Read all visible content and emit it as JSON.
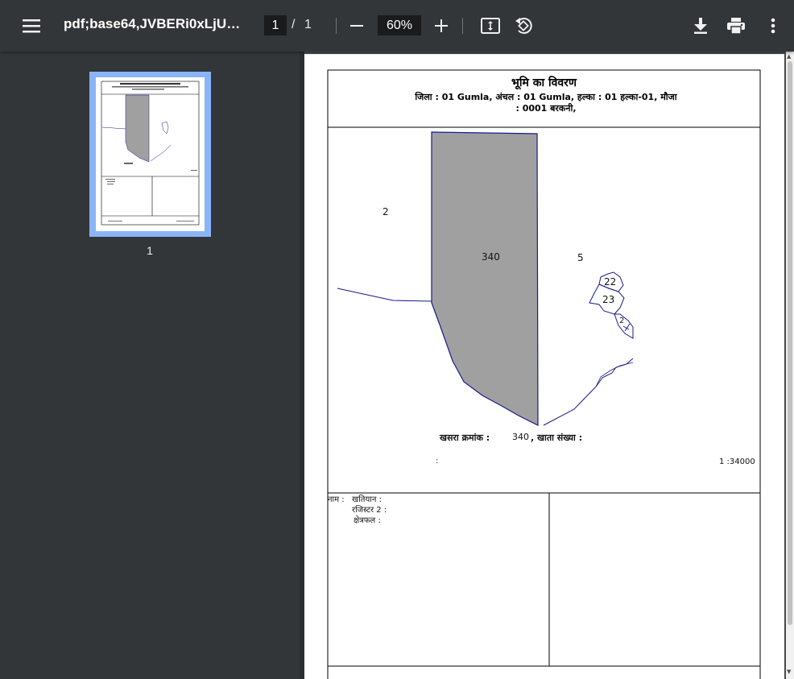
{
  "toolbar": {
    "title": "pdf;base64,JVBERi0xLjUKJ...",
    "current_page": "1",
    "page_separator": "/",
    "total_pages": "1",
    "zoom": "60%"
  },
  "sidebar": {
    "thumbnails": [
      {
        "label": "1"
      }
    ]
  },
  "document": {
    "title": "भूमि का विवरण",
    "subtitle_line1": "जिला : 01 Gumla, अंचल : 01 Gumla, हल्का : 01 हल्का-01, मौजा",
    "subtitle_line2": ": 0001 बरकनी,",
    "plot_number": "340",
    "neighbor_left": "2",
    "neighbor_right": "5",
    "neighbor_a": "22",
    "neighbor_b": "23",
    "neighbor_c": "2",
    "khasra_label": "खसरा क्रमांक :",
    "khasra_value": "340",
    "khata_label": ", खाता संख्या :",
    "colon_text": ":",
    "scale": "1 :34000",
    "owner_name_label": "नाम :",
    "khatiyan_label": "खतियान :",
    "register_label": "रजिस्टर 2 :",
    "area_label": "क्षेत्रफल :"
  },
  "colors": {
    "toolbar_bg": "#323639",
    "viewer_bg": "#525659",
    "thumbnail_highlight": "#8ab4f8",
    "plot_fill": "#a0a0a0",
    "boundary_line": "#1a1a8c"
  }
}
